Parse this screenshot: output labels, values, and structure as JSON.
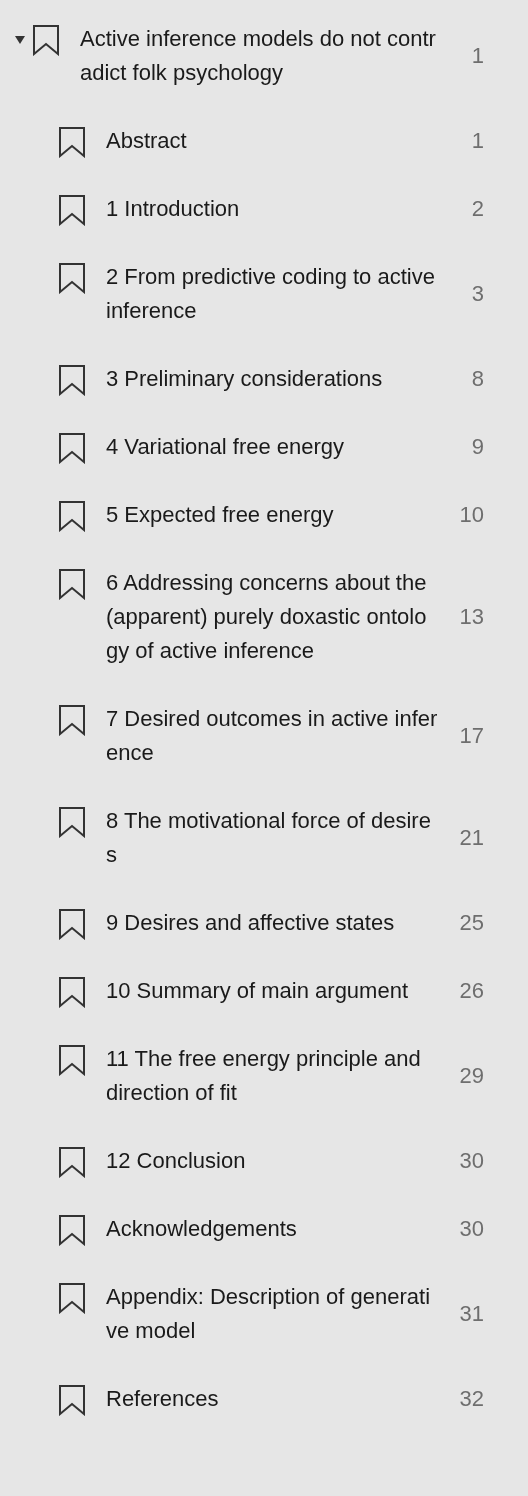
{
  "outline": {
    "title": "Active inference models do not contradict folk psychology",
    "page": "1",
    "expanded": true,
    "children": [
      {
        "title": "Abstract",
        "page": "1"
      },
      {
        "title": "1 Introduction",
        "page": "2"
      },
      {
        "title": "2 From predictive coding to active inference",
        "page": "3"
      },
      {
        "title": "3 Preliminary considerations",
        "page": "8"
      },
      {
        "title": "4 Variational free energy",
        "page": "9"
      },
      {
        "title": "5 Expected free energy",
        "page": "10"
      },
      {
        "title": "6 Addressing concerns about the (apparent) purely doxastic ontology of active inference",
        "page": "13"
      },
      {
        "title": "7 Desired outcomes in active inference",
        "page": "17"
      },
      {
        "title": "8 The motivational force of desires",
        "page": "21"
      },
      {
        "title": "9 Desires and affective states",
        "page": "25"
      },
      {
        "title": "10 Summary of main argument",
        "page": "26"
      },
      {
        "title": "11 The free energy principle and direction of fit",
        "page": "29"
      },
      {
        "title": "12 Conclusion",
        "page": "30"
      },
      {
        "title": "Acknowledgements",
        "page": "30"
      },
      {
        "title": "Appendix: Description of generative model",
        "page": "31"
      },
      {
        "title": "References",
        "page": "32"
      }
    ]
  }
}
